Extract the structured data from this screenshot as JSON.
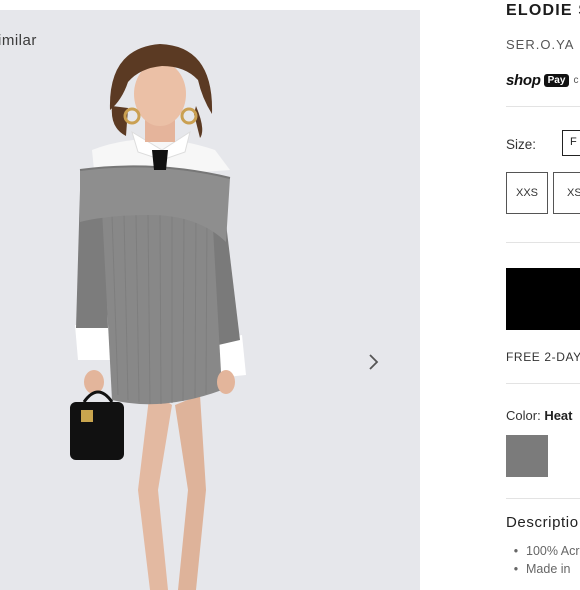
{
  "gallery": {
    "shop_similar_label": "imilar",
    "next_icon": "chevron-right-icon"
  },
  "product": {
    "title": "ELODIE S",
    "brand": "SER.O.YA",
    "shoppay": {
      "shop": "shop",
      "pay": "Pay",
      "trail": "c"
    },
    "size": {
      "label": "Size:",
      "selected": "F",
      "options": [
        "XXS",
        "XS"
      ]
    },
    "shipping_text": "FREE 2-DAY",
    "color": {
      "label": "Color:",
      "value": "Heat",
      "swatch": "#7b7b7b"
    },
    "description": {
      "title": "Descriptio",
      "items": [
        "100% Acr",
        "Made in"
      ]
    }
  }
}
